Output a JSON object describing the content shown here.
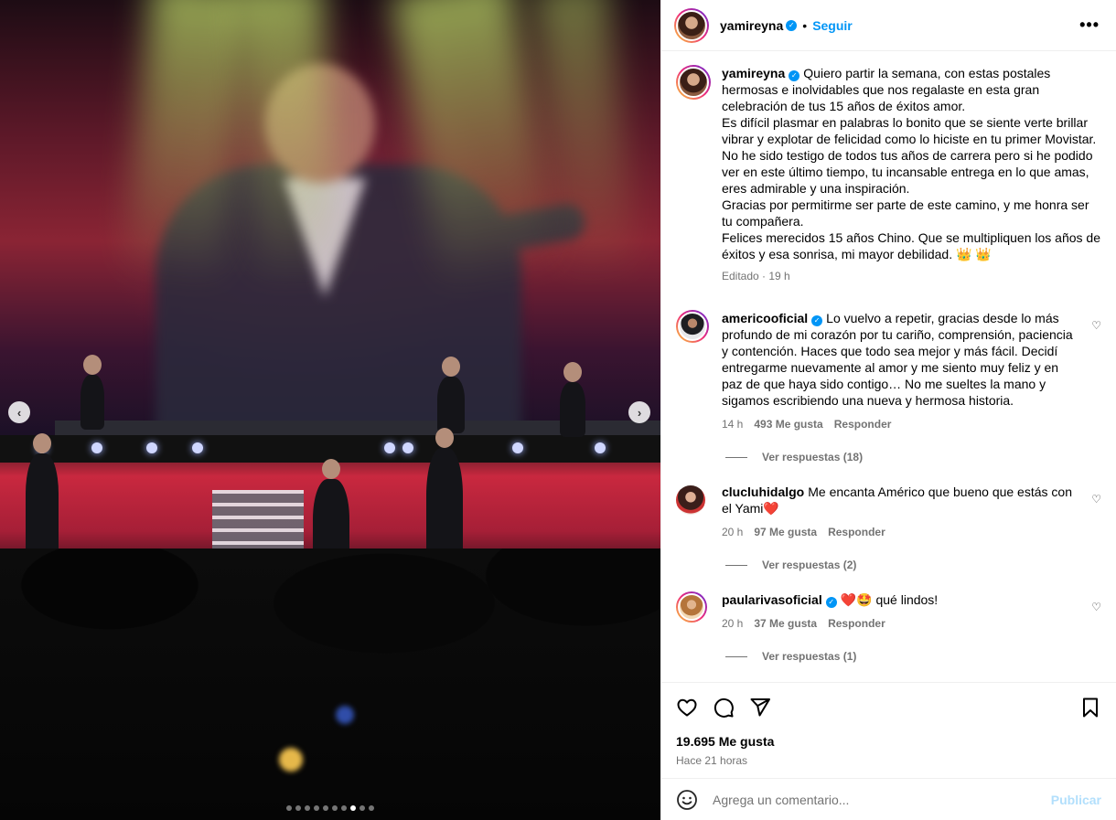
{
  "post": {
    "author": "yamireyna",
    "separator": "•",
    "follow_label": "Seguir",
    "more_label": "•••",
    "caption": "Quiero partir la semana, con estas postales hermosas e inolvidables que nos regalaste en esta gran celebración de tus 15 años de éxitos amor.\nEs difícil plasmar en palabras lo bonito que se siente verte brillar vibrar y explotar de felicidad como lo hiciste en tu primer Movistar.\nNo he sido testigo de todos tus años de carrera pero si he podido ver en este último tiempo, tu incansable entrega en lo que amas, eres admirable y una inspiración.\nGracias por permitirme ser parte de este camino, y me honra ser tu compañera.\nFelices merecidos 15 años Chino. Que se multipliquen los años de éxitos y esa sonrisa, mi mayor debilidad. 👑 👑",
    "edited_label": "Editado · 19 h"
  },
  "carousel": {
    "dots_total": 10,
    "active_index": 7,
    "prev_label": "‹",
    "next_label": "›"
  },
  "comments": [
    {
      "user": "americooficial",
      "verified": true,
      "text": "Lo vuelvo a repetir, gracias desde lo más profundo de mi corazón por tu cariño, comprensión, paciencia y contención. Haces que todo sea mejor y más fácil. Decidí entregarme nuevamente al amor y me siento muy feliz y en paz de que haya sido contigo… No me sueltes la mano y sigamos escribiendo una nueva y hermosa historia.",
      "time": "14 h",
      "likes": "493 Me gusta",
      "reply": "Responder",
      "view_replies": "Ver respuestas (18)"
    },
    {
      "user": "clucluhidalgo",
      "verified": false,
      "text": "Me encanta Américo que bueno que estás con el Yami❤️",
      "time": "20 h",
      "likes": "97 Me gusta",
      "reply": "Responder",
      "view_replies": "Ver respuestas (2)"
    },
    {
      "user": "paularivasoficial",
      "verified": true,
      "text": "❤️🤩 qué lindos!",
      "time": "20 h",
      "likes": "37 Me gusta",
      "reply": "Responder",
      "view_replies": "Ver respuestas (1)"
    }
  ],
  "stats": {
    "likes": "19.695 Me gusta",
    "time": "Hace 21 horas"
  },
  "composer": {
    "placeholder": "Agrega un comentario...",
    "publish_label": "Publicar"
  },
  "icons": {
    "verified": "✓",
    "heart_small": "♡"
  }
}
